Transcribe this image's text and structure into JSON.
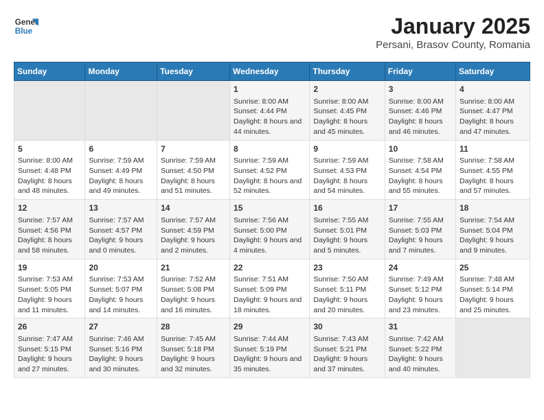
{
  "logo": {
    "line1": "General",
    "line2": "Blue"
  },
  "title": "January 2025",
  "subtitle": "Persani, Brasov County, Romania",
  "weekdays": [
    "Sunday",
    "Monday",
    "Tuesday",
    "Wednesday",
    "Thursday",
    "Friday",
    "Saturday"
  ],
  "weeks": [
    [
      {
        "day": "",
        "empty": true
      },
      {
        "day": "",
        "empty": true
      },
      {
        "day": "",
        "empty": true
      },
      {
        "day": "1",
        "sunrise": "8:00 AM",
        "sunset": "4:44 PM",
        "daylight": "8 hours and 44 minutes."
      },
      {
        "day": "2",
        "sunrise": "8:00 AM",
        "sunset": "4:45 PM",
        "daylight": "8 hours and 45 minutes."
      },
      {
        "day": "3",
        "sunrise": "8:00 AM",
        "sunset": "4:46 PM",
        "daylight": "8 hours and 46 minutes."
      },
      {
        "day": "4",
        "sunrise": "8:00 AM",
        "sunset": "4:47 PM",
        "daylight": "8 hours and 47 minutes."
      }
    ],
    [
      {
        "day": "5",
        "sunrise": "8:00 AM",
        "sunset": "4:48 PM",
        "daylight": "8 hours and 48 minutes."
      },
      {
        "day": "6",
        "sunrise": "7:59 AM",
        "sunset": "4:49 PM",
        "daylight": "8 hours and 49 minutes."
      },
      {
        "day": "7",
        "sunrise": "7:59 AM",
        "sunset": "4:50 PM",
        "daylight": "8 hours and 51 minutes."
      },
      {
        "day": "8",
        "sunrise": "7:59 AM",
        "sunset": "4:52 PM",
        "daylight": "8 hours and 52 minutes."
      },
      {
        "day": "9",
        "sunrise": "7:59 AM",
        "sunset": "4:53 PM",
        "daylight": "8 hours and 54 minutes."
      },
      {
        "day": "10",
        "sunrise": "7:58 AM",
        "sunset": "4:54 PM",
        "daylight": "8 hours and 55 minutes."
      },
      {
        "day": "11",
        "sunrise": "7:58 AM",
        "sunset": "4:55 PM",
        "daylight": "8 hours and 57 minutes."
      }
    ],
    [
      {
        "day": "12",
        "sunrise": "7:57 AM",
        "sunset": "4:56 PM",
        "daylight": "8 hours and 58 minutes."
      },
      {
        "day": "13",
        "sunrise": "7:57 AM",
        "sunset": "4:57 PM",
        "daylight": "9 hours and 0 minutes."
      },
      {
        "day": "14",
        "sunrise": "7:57 AM",
        "sunset": "4:59 PM",
        "daylight": "9 hours and 2 minutes."
      },
      {
        "day": "15",
        "sunrise": "7:56 AM",
        "sunset": "5:00 PM",
        "daylight": "9 hours and 4 minutes."
      },
      {
        "day": "16",
        "sunrise": "7:55 AM",
        "sunset": "5:01 PM",
        "daylight": "9 hours and 5 minutes."
      },
      {
        "day": "17",
        "sunrise": "7:55 AM",
        "sunset": "5:03 PM",
        "daylight": "9 hours and 7 minutes."
      },
      {
        "day": "18",
        "sunrise": "7:54 AM",
        "sunset": "5:04 PM",
        "daylight": "9 hours and 9 minutes."
      }
    ],
    [
      {
        "day": "19",
        "sunrise": "7:53 AM",
        "sunset": "5:05 PM",
        "daylight": "9 hours and 11 minutes."
      },
      {
        "day": "20",
        "sunrise": "7:53 AM",
        "sunset": "5:07 PM",
        "daylight": "9 hours and 14 minutes."
      },
      {
        "day": "21",
        "sunrise": "7:52 AM",
        "sunset": "5:08 PM",
        "daylight": "9 hours and 16 minutes."
      },
      {
        "day": "22",
        "sunrise": "7:51 AM",
        "sunset": "5:09 PM",
        "daylight": "9 hours and 18 minutes."
      },
      {
        "day": "23",
        "sunrise": "7:50 AM",
        "sunset": "5:11 PM",
        "daylight": "9 hours and 20 minutes."
      },
      {
        "day": "24",
        "sunrise": "7:49 AM",
        "sunset": "5:12 PM",
        "daylight": "9 hours and 23 minutes."
      },
      {
        "day": "25",
        "sunrise": "7:48 AM",
        "sunset": "5:14 PM",
        "daylight": "9 hours and 25 minutes."
      }
    ],
    [
      {
        "day": "26",
        "sunrise": "7:47 AM",
        "sunset": "5:15 PM",
        "daylight": "9 hours and 27 minutes."
      },
      {
        "day": "27",
        "sunrise": "7:46 AM",
        "sunset": "5:16 PM",
        "daylight": "9 hours and 30 minutes."
      },
      {
        "day": "28",
        "sunrise": "7:45 AM",
        "sunset": "5:18 PM",
        "daylight": "9 hours and 32 minutes."
      },
      {
        "day": "29",
        "sunrise": "7:44 AM",
        "sunset": "5:19 PM",
        "daylight": "9 hours and 35 minutes."
      },
      {
        "day": "30",
        "sunrise": "7:43 AM",
        "sunset": "5:21 PM",
        "daylight": "9 hours and 37 minutes."
      },
      {
        "day": "31",
        "sunrise": "7:42 AM",
        "sunset": "5:22 PM",
        "daylight": "9 hours and 40 minutes."
      },
      {
        "day": "",
        "empty": true
      }
    ]
  ]
}
